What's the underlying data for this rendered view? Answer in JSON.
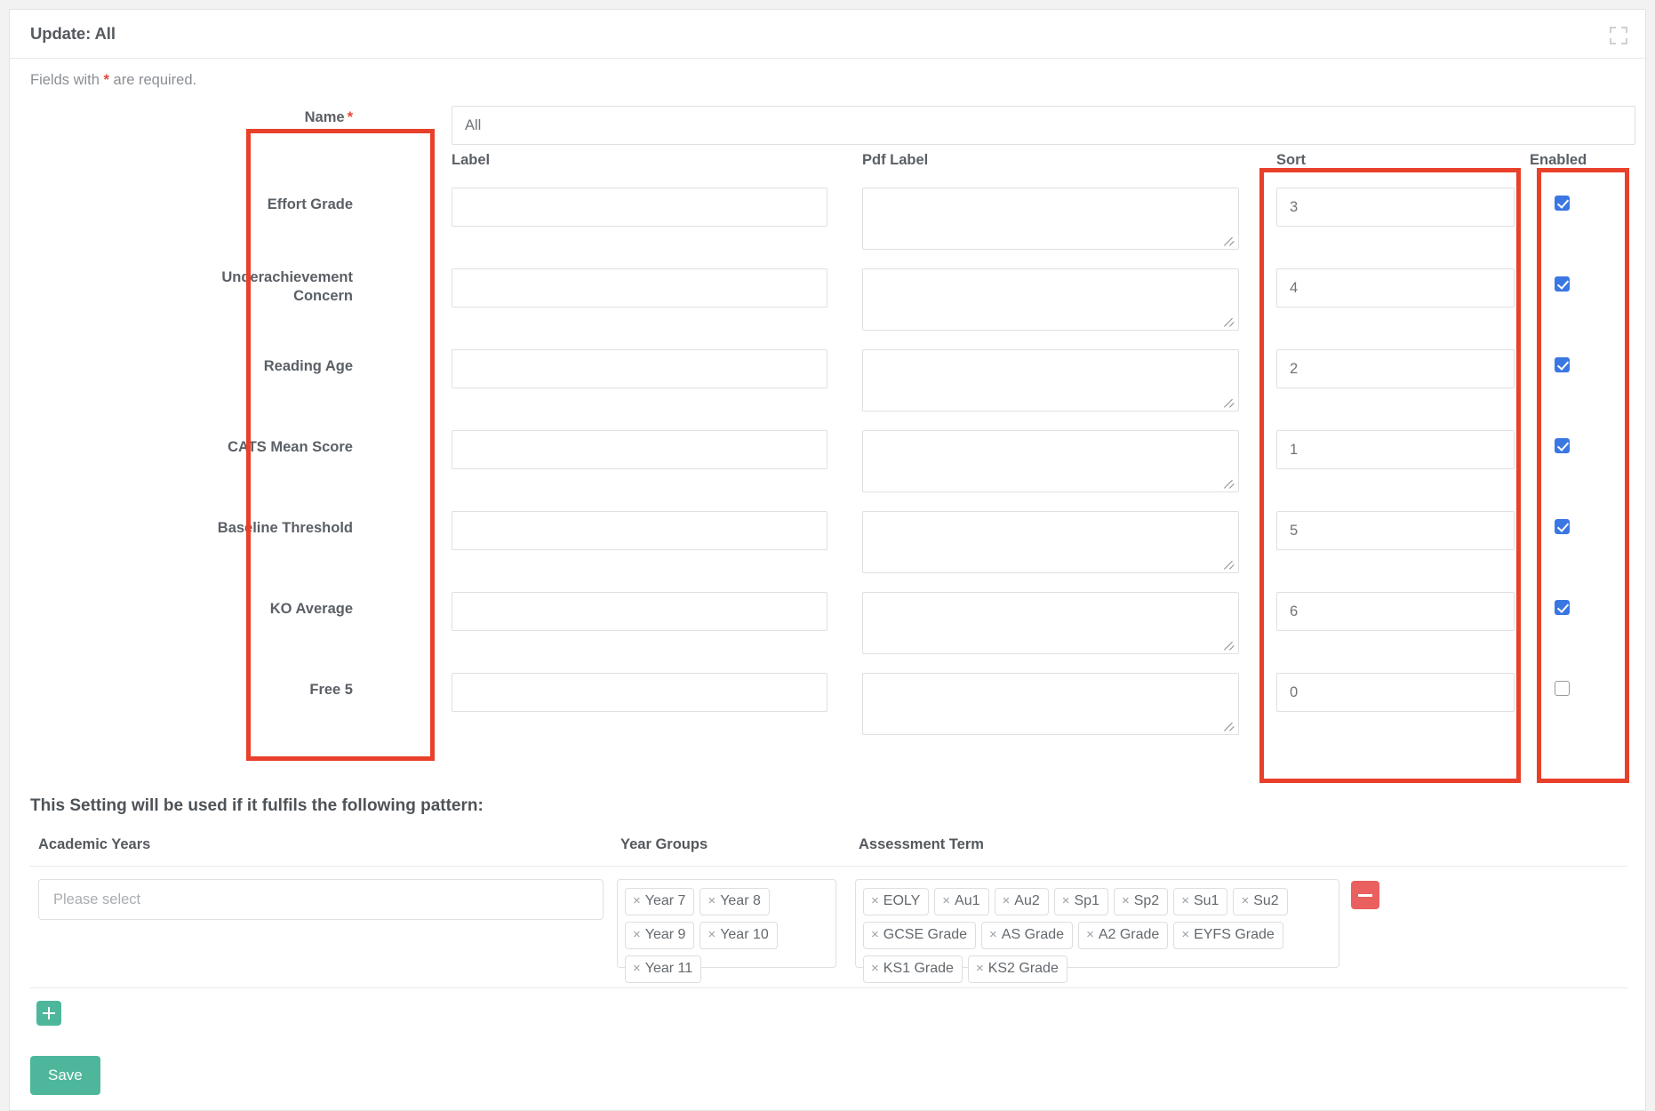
{
  "window": {
    "title": "Update: All",
    "expand_icon": "expand-icon"
  },
  "required_note": {
    "before": "Fields with ",
    "star": "*",
    "after": " are required."
  },
  "name_field": {
    "label": "Name",
    "required_marker": "*",
    "value": "All"
  },
  "columns": {
    "label": "Label",
    "pdf_label": "Pdf Label",
    "sort": "Sort",
    "enabled": "Enabled"
  },
  "rows": [
    {
      "name": "Effort Grade",
      "label": "",
      "pdf_label": "",
      "sort": "3",
      "enabled": true
    },
    {
      "name": "Underachievement Concern",
      "label": "",
      "pdf_label": "",
      "sort": "4",
      "enabled": true
    },
    {
      "name": "Reading Age",
      "label": "",
      "pdf_label": "",
      "sort": "2",
      "enabled": true
    },
    {
      "name": "CATS Mean Score",
      "label": "",
      "pdf_label": "",
      "sort": "1",
      "enabled": true
    },
    {
      "name": "Baseline Threshold",
      "label": "",
      "pdf_label": "",
      "sort": "5",
      "enabled": true
    },
    {
      "name": "KO Average",
      "label": "",
      "pdf_label": "",
      "sort": "6",
      "enabled": true
    },
    {
      "name": "Free 5",
      "label": "",
      "pdf_label": "",
      "sort": "0",
      "enabled": false
    }
  ],
  "pattern": {
    "section_title": "This Setting will be used if it fulfils the following pattern:",
    "academic_years": {
      "heading": "Academic Years",
      "placeholder": "Please select",
      "tags": []
    },
    "year_groups": {
      "heading": "Year Groups",
      "tags": [
        "Year 7",
        "Year 8",
        "Year 9",
        "Year 10",
        "Year 11"
      ]
    },
    "assessment_term": {
      "heading": "Assessment Term",
      "tags": [
        "EOLY",
        "Au1",
        "Au2",
        "Sp1",
        "Sp2",
        "Su1",
        "Su2",
        "GCSE Grade",
        "AS Grade",
        "A2 Grade",
        "EYFS Grade",
        "KS1 Grade",
        "KS2 Grade"
      ]
    },
    "remove_button": "−",
    "add_button": "+"
  },
  "actions": {
    "save_label": "Save"
  },
  "colors": {
    "accent_green": "#4eb79b",
    "danger_red": "#e9605f",
    "highlight_red": "#e8402a",
    "checkbox_blue": "#3b77e3",
    "required_star": "#e8493a"
  },
  "tag_remove_glyph": "×"
}
